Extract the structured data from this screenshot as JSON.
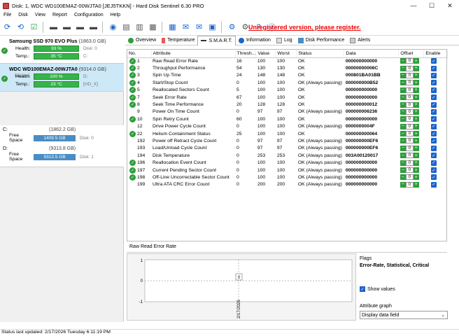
{
  "window": {
    "title": "Disk: 1, WDC WD100EMAZ-00WJTA0 [JEJ5TKKN]  -  Hard Disk Sentinel 6.30 PRO"
  },
  "menu": [
    "File",
    "Disk",
    "View",
    "Report",
    "Configuration",
    "Help"
  ],
  "unregistered": "Unregistered version, please register.",
  "disks": [
    {
      "name": "Samsung SSD 970 EVO Plus",
      "capacity": "(1863.0 GB)",
      "health_label": "Health:",
      "health": "93 %",
      "health_value": 93,
      "disk": "Disk: 0",
      "temp_label": "Temp.:",
      "temp": "35 °C",
      "drive": "C:"
    },
    {
      "name": "WDC WD100EMAZ-00WJTA0",
      "capacity": "(9314.0 GB)",
      "disk": "Disk: 1",
      "health_label": "Health:",
      "health": "100 %",
      "health_value": 100,
      "drive": "D:",
      "temp_label": "Temp.:",
      "temp": "23 °C",
      "extra": "[HD_X]"
    }
  ],
  "volumes": [
    {
      "letter": "C:",
      "capacity": "(1862.2 GB)",
      "free_label": "Free Space",
      "free": "1409.5 GB",
      "disk": "Disk: 0"
    },
    {
      "letter": "D:",
      "capacity": "(9313.8 GB)",
      "free_label": "Free Space",
      "free": "9313.5 GB",
      "disk": "Disk: 1"
    }
  ],
  "tabs": [
    "Overview",
    "Temperature",
    "S.M.A.R.T.",
    "Information",
    "Log",
    "Disk Performance",
    "Alerts"
  ],
  "table": {
    "headers": [
      "No.",
      "Attribute",
      "Thresh...",
      "Value",
      "Worst",
      "Status",
      "Data",
      "Offset",
      "Enable"
    ],
    "rows": [
      [
        "1",
        "Raw Read Error Rate",
        "16",
        "100",
        "100",
        "OK",
        "000000000000",
        "0"
      ],
      [
        "2",
        "Throughput Performance",
        "54",
        "130",
        "130",
        "OK",
        "00000000006C",
        "0"
      ],
      [
        "3",
        "Spin Up Time",
        "24",
        "148",
        "148",
        "OK",
        "000801BA01BB",
        "0"
      ],
      [
        "4",
        "Start/Stop Count",
        "0",
        "100",
        "100",
        "OK (Always passing)",
        "000000000B52",
        "0"
      ],
      [
        "5",
        "Reallocated Sectors Count",
        "5",
        "100",
        "100",
        "OK",
        "000000000000",
        "0"
      ],
      [
        "7",
        "Seek Error Rate",
        "67",
        "100",
        "100",
        "OK",
        "000000000000",
        "0"
      ],
      [
        "8",
        "Seek Time Performance",
        "20",
        "128",
        "128",
        "OK",
        "000000000012",
        "0"
      ],
      [
        "9",
        "Power On Time Count",
        "0",
        "97",
        "97",
        "OK (Always passing)",
        "000000006236",
        "0"
      ],
      [
        "10",
        "Spin Retry Count",
        "60",
        "100",
        "100",
        "OK",
        "000000000000",
        "0"
      ],
      [
        "12",
        "Drive Power Cycle Count",
        "0",
        "100",
        "100",
        "OK (Always passing)",
        "0000000004F",
        "0"
      ],
      [
        "22",
        "Helium Containment Status",
        "25",
        "100",
        "100",
        "OK",
        "000000000064",
        "0"
      ],
      [
        "192",
        "Power off Retract Cycle Count",
        "0",
        "97",
        "97",
        "OK (Always passing)",
        "000000000EF6",
        "0"
      ],
      [
        "193",
        "Load/Unload Cycle Count",
        "0",
        "97",
        "97",
        "OK (Always passing)",
        "000000000EF6",
        "0"
      ],
      [
        "194",
        "Disk Temperature",
        "0",
        "253",
        "253",
        "OK (Always passing)",
        "003A00120017",
        "0"
      ],
      [
        "196",
        "Reallocation Event Count",
        "0",
        "100",
        "100",
        "OK (Always passing)",
        "000000000000",
        "0"
      ],
      [
        "197",
        "Current Pending Sector Count",
        "0",
        "100",
        "100",
        "OK (Always passing)",
        "000000000000",
        "0"
      ],
      [
        "198",
        "Off-Line Uncorrectable Sector Count",
        "0",
        "100",
        "100",
        "OK (Always passing)",
        "000000000000",
        "0"
      ],
      [
        "199",
        "Ultra ATA CRC Error Count",
        "0",
        "200",
        "200",
        "OK (Always passing)",
        "000000000000",
        "0"
      ]
    ],
    "ok_icon_rows": [
      "1",
      "2",
      "3",
      "4",
      "5",
      "7",
      "8",
      "10",
      "22",
      "196",
      "197",
      "198"
    ]
  },
  "graph": {
    "title": "Raw Read Error Rate",
    "y_top": "1",
    "y_mid": "0",
    "y_bot": "-1",
    "point": "0",
    "date": "2/17/2026"
  },
  "flags": {
    "label": "Flags",
    "value": "Error-Rate, Statistical, Critical",
    "show_values": "Show values",
    "attr_graph": "Attribute graph",
    "select": "Display data field"
  },
  "status": "Status last updated: 2/17/2026 Tuesday 6:11:19 PM"
}
